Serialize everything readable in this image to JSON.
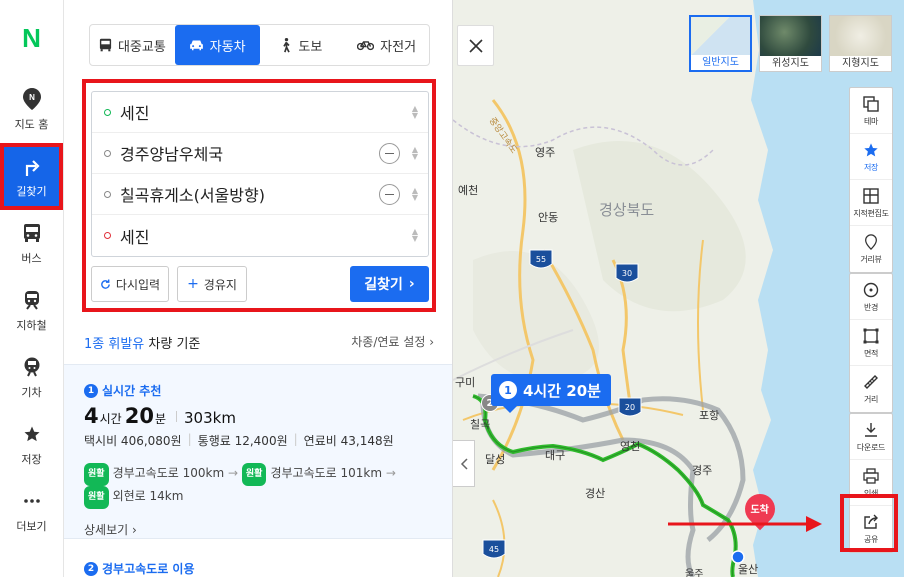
{
  "rail": {
    "logo": "N",
    "items": [
      {
        "label": "지도 홈"
      },
      {
        "label": "길찾기"
      },
      {
        "label": "버스"
      },
      {
        "label": "지하철"
      },
      {
        "label": "기차"
      },
      {
        "label": "저장"
      },
      {
        "label": "더보기"
      }
    ]
  },
  "modes": [
    {
      "label": "대중교통"
    },
    {
      "label": "자동차"
    },
    {
      "label": "도보"
    },
    {
      "label": "자전거"
    }
  ],
  "stops": [
    {
      "text": "세진"
    },
    {
      "text": "경주양남우체국"
    },
    {
      "text": "칠곡휴게소(서울방향)"
    },
    {
      "text": "세진"
    }
  ],
  "buttons": {
    "reset": "다시입력",
    "waypoint": "경유지",
    "search": "길찾기"
  },
  "basis": {
    "vehicle": "1종 휘발유",
    "suffix": "차량 기준",
    "settings": "차종/연료 설정"
  },
  "route1": {
    "num": "1",
    "title": "실시간 추천",
    "hours": "4",
    "hours_unit": "시간",
    "minutes": "20",
    "minutes_unit": "분",
    "distance": "303km",
    "taxi": "택시비 406,080원",
    "toll": "통행료 12,400원",
    "fuel": "연료비 43,148원",
    "badge": "원활",
    "road1": "경부고속도로 100km",
    "road2": "경부고속도로 101km",
    "road3": "외현로 14km",
    "detail": "상세보기"
  },
  "route2": {
    "num": "2",
    "title": "경부고속도로 이용"
  },
  "map": {
    "types": [
      {
        "label": "일반지도"
      },
      {
        "label": "위성지도"
      },
      {
        "label": "지형지도"
      }
    ],
    "controls": {
      "theme": "테마",
      "save": "저장",
      "cadastral": "지적편집도",
      "streetview": "거리뷰",
      "radius": "반경",
      "area": "면적",
      "distance": "거리",
      "download": "다운로드",
      "print": "인쇄",
      "share": "공유"
    },
    "bubble": {
      "num": "1",
      "text": "4시간 20분"
    },
    "arrive": "도착",
    "waypoint_num": "2",
    "labels": {
      "yeongju": "영주",
      "yecheon": "예천",
      "andong": "안동",
      "gyeongbuk": "경상북도",
      "gumi": "구미",
      "chilgok": "칠곡",
      "dalseong": "달성",
      "daegu": "대구",
      "yeongcheon": "영천",
      "gyeongju": "경주",
      "pohang": "포항",
      "gyeongsan": "경산",
      "ulsan": "울산",
      "jungang": "중앙고속도",
      "ulju": "울주",
      "hw55": "55",
      "hw30": "30",
      "hw20": "20",
      "hw45": "45"
    }
  },
  "colors": {
    "accent": "#1b6cf0",
    "naver_green": "#03c75a",
    "highlight_red": "#e8151b",
    "route_green": "#2fbb2c"
  }
}
